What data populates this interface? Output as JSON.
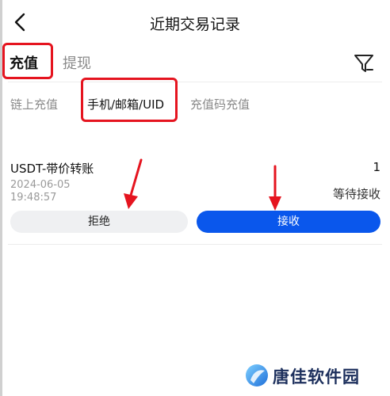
{
  "header": {
    "title": "近期交易记录",
    "back_icon": "chevron-left-icon"
  },
  "tabs": [
    {
      "label": "充值",
      "active": true
    },
    {
      "label": "提现",
      "active": false
    }
  ],
  "filter_icon": "filter-icon",
  "subtabs": [
    {
      "label": "链上充值",
      "active": false
    },
    {
      "label": "手机/邮箱/UID",
      "active": true
    },
    {
      "label": "充值码充值",
      "active": false
    }
  ],
  "record": {
    "title": "USDT-带价转账",
    "count": "1",
    "date": "2024-06-05",
    "time": "19:48:57",
    "status": "等待接收",
    "reject_label": "拒绝",
    "accept_label": "接收"
  },
  "watermark": {
    "text": "唐佳软件园"
  },
  "colors": {
    "accent": "#0a57ec",
    "highlight": "#e5141f",
    "muted": "#8a8a8a"
  }
}
